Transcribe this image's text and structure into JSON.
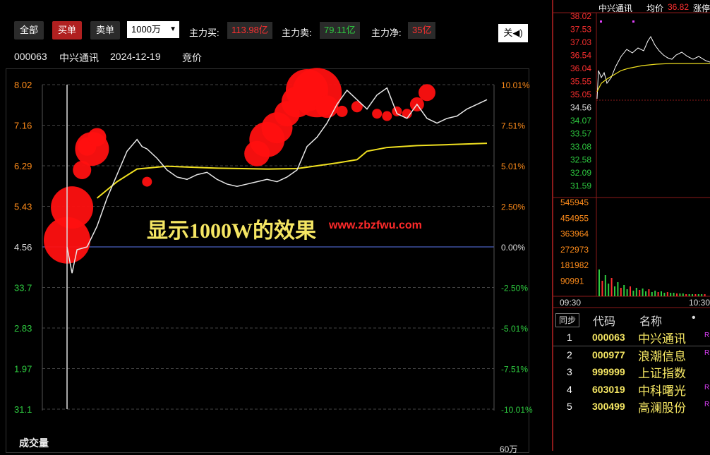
{
  "toolbar": {
    "all_label": "全部",
    "buy_label": "买单",
    "sell_label": "卖单",
    "amount_select": "1000万",
    "main_buy_label": "主力买:",
    "main_buy_value": "113.98亿",
    "main_sell_label": "主力卖:",
    "main_sell_value": "79.11亿",
    "main_net_label": "主力净:",
    "main_net_value": "35亿",
    "close_label": "关◀)"
  },
  "stock_info": {
    "code": "000063",
    "name": "中兴通讯",
    "date": "2024-12-19",
    "mode": "竞价"
  },
  "overlay_text": "显示1000W的效果",
  "watermark": "www.zbzfwu.com",
  "volume_label": "成交量",
  "volume_axis_label": "60万",
  "chart_data": {
    "type": "line",
    "y_left_ticks": [
      "8.02",
      "7.16",
      "6.29",
      "5.43",
      "4.56",
      "33.7",
      "2.83",
      "1.97",
      "31.1"
    ],
    "y_right_ticks": [
      "10.01%",
      "7.51%",
      "5.01%",
      "2.50%",
      "0.00%",
      "-2.50%",
      "-5.01%",
      "-7.51%",
      "-10.01%"
    ],
    "ylim": [
      3.11,
      8.02
    ],
    "base": 4.56,
    "price": [
      [
        0,
        4.56
      ],
      [
        1,
        4.0
      ],
      [
        2,
        4.5
      ],
      [
        4,
        4.56
      ],
      [
        6,
        5.0
      ],
      [
        8,
        5.6
      ],
      [
        10,
        6.1
      ],
      [
        12,
        6.6
      ],
      [
        14,
        6.85
      ],
      [
        15,
        6.7
      ],
      [
        16,
        6.65
      ],
      [
        18,
        6.45
      ],
      [
        20,
        6.2
      ],
      [
        22,
        6.05
      ],
      [
        24,
        6.0
      ],
      [
        26,
        6.1
      ],
      [
        28,
        6.15
      ],
      [
        30,
        6.0
      ],
      [
        32,
        5.9
      ],
      [
        34,
        5.85
      ],
      [
        36,
        5.9
      ],
      [
        38,
        5.95
      ],
      [
        40,
        6.0
      ],
      [
        42,
        5.95
      ],
      [
        44,
        6.05
      ],
      [
        46,
        6.2
      ],
      [
        48,
        6.7
      ],
      [
        50,
        6.9
      ],
      [
        52,
        7.2
      ],
      [
        54,
        7.6
      ],
      [
        56,
        7.9
      ],
      [
        58,
        7.7
      ],
      [
        60,
        7.5
      ],
      [
        62,
        7.8
      ],
      [
        64,
        7.95
      ],
      [
        66,
        7.4
      ],
      [
        68,
        7.3
      ],
      [
        70,
        7.6
      ],
      [
        72,
        7.3
      ],
      [
        74,
        7.2
      ],
      [
        76,
        7.3
      ],
      [
        78,
        7.35
      ],
      [
        80,
        7.5
      ],
      [
        82,
        7.6
      ],
      [
        84,
        7.7
      ]
    ],
    "avg": [
      [
        6,
        5.6
      ],
      [
        10,
        5.95
      ],
      [
        14,
        6.22
      ],
      [
        20,
        6.28
      ],
      [
        30,
        6.24
      ],
      [
        40,
        6.22
      ],
      [
        46,
        6.23
      ],
      [
        50,
        6.29
      ],
      [
        54,
        6.35
      ],
      [
        58,
        6.42
      ],
      [
        60,
        6.6
      ],
      [
        64,
        6.68
      ],
      [
        70,
        6.72
      ],
      [
        76,
        6.74
      ],
      [
        84,
        6.77
      ]
    ],
    "bubbles": [
      [
        0,
        4.7,
        3.3
      ],
      [
        1,
        5.4,
        3.0
      ],
      [
        3,
        6.2,
        1.3
      ],
      [
        4,
        6.7,
        1.3
      ],
      [
        5,
        6.65,
        2.4
      ],
      [
        6,
        6.9,
        1.3
      ],
      [
        16,
        5.95,
        0.7
      ],
      [
        38,
        6.55,
        1.8
      ],
      [
        40,
        6.85,
        2.5
      ],
      [
        42,
        7.1,
        2.2
      ],
      [
        44,
        7.4,
        1.8
      ],
      [
        46,
        7.65,
        2.2
      ],
      [
        48,
        7.9,
        3.0
      ],
      [
        50,
        7.85,
        3.5
      ],
      [
        52,
        7.55,
        1.6
      ],
      [
        55,
        7.45,
        0.8
      ],
      [
        58,
        7.55,
        0.8
      ],
      [
        62,
        7.4,
        0.7
      ],
      [
        64,
        7.35,
        0.7
      ],
      [
        66,
        7.45,
        0.7
      ],
      [
        68,
        7.4,
        0.7
      ],
      [
        70,
        7.6,
        1.0
      ],
      [
        72,
        7.85,
        1.2
      ]
    ]
  },
  "right_panel": {
    "title": "中兴通讯",
    "avg_label": "均价",
    "avg_value": "36.82",
    "extra_label": "涨停",
    "price_ticks": [
      "38.02",
      "37.53",
      "37.03",
      "36.54",
      "36.04",
      "35.55",
      "35.05",
      "34.56",
      "34.07",
      "33.57",
      "33.08",
      "32.58",
      "32.09",
      "31.59"
    ],
    "volume_ticks": [
      "545945",
      "454955",
      "363964",
      "272973",
      "181982",
      "90991"
    ],
    "time_start": "09:30",
    "time_end": "10:30"
  },
  "stock_list": {
    "tab_label": "同步",
    "col_code": "代码",
    "col_name": "名称",
    "col_dot": "•",
    "rows": [
      {
        "num": "1",
        "code": "000063",
        "name": "中兴通讯",
        "tag": "R"
      },
      {
        "num": "2",
        "code": "000977",
        "name": "浪潮信息",
        "tag": "R"
      },
      {
        "num": "3",
        "code": "999999",
        "name": "上证指数",
        "tag": ""
      },
      {
        "num": "4",
        "code": "603019",
        "name": "中科曙光",
        "tag": "R"
      },
      {
        "num": "5",
        "code": "300499",
        "name": "高澜股份",
        "tag": "R"
      }
    ]
  },
  "colors": {
    "red": "#ff1a1a",
    "yellow": "#f5e663",
    "green": "#2ecc40",
    "orange": "#ff8c1a"
  }
}
